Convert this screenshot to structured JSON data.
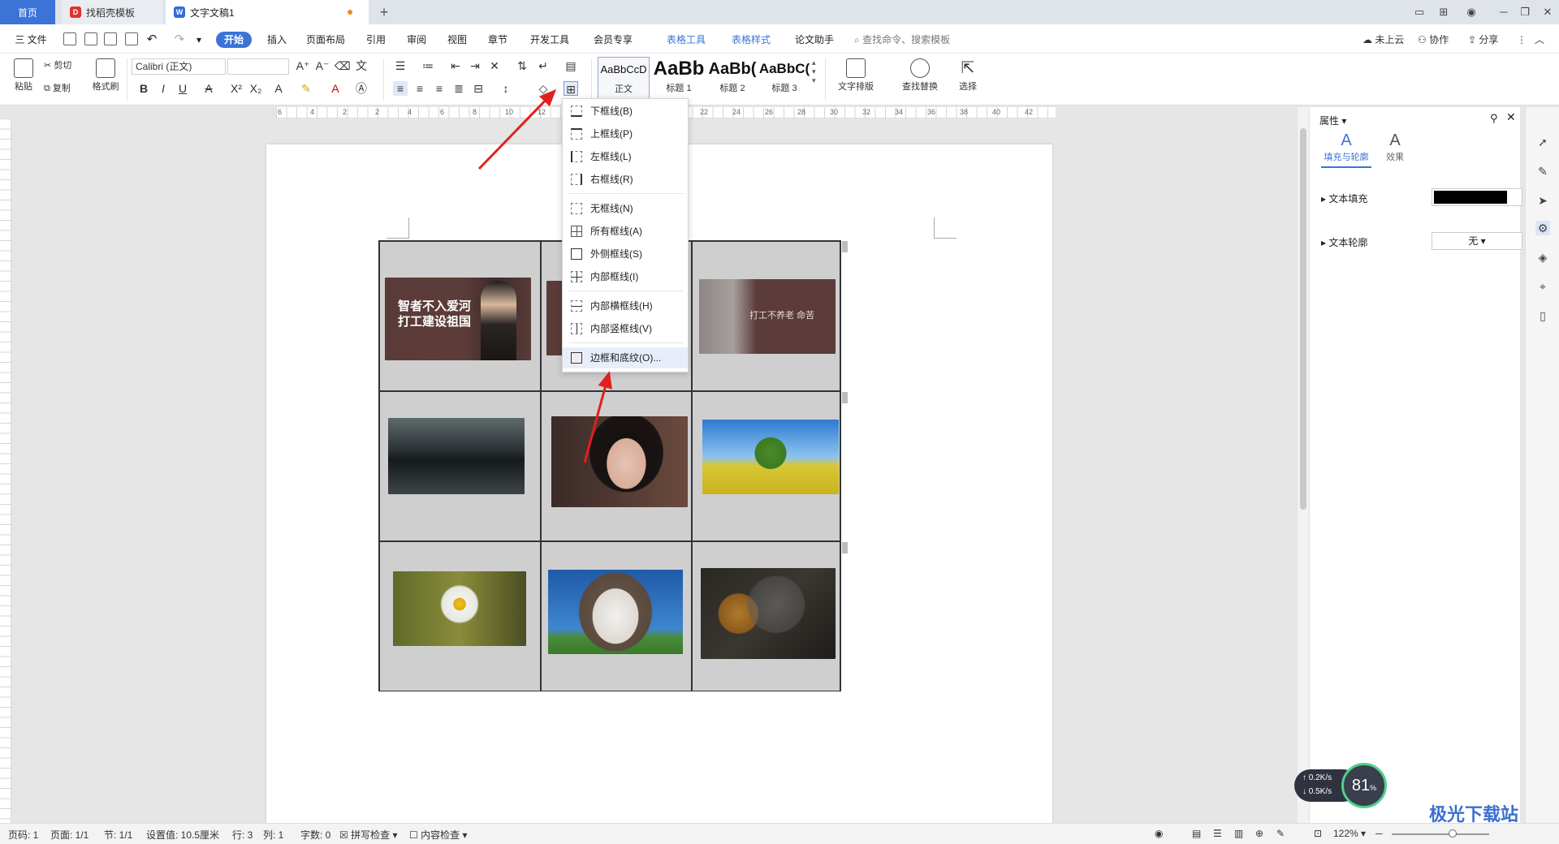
{
  "titlebar": {
    "tabs": [
      {
        "label": "首页"
      },
      {
        "label": "找稻壳模板"
      },
      {
        "label": "文字文稿1"
      }
    ],
    "add_label": "+"
  },
  "menubar": {
    "file": "三 文件",
    "items": [
      "开始",
      "插入",
      "页面布局",
      "引用",
      "审阅",
      "视图",
      "章节",
      "开发工具",
      "会员专享",
      "表格工具",
      "表格样式",
      "论文助手"
    ],
    "search": "查找命令、搜索模板",
    "cloud": "未上云",
    "collab": "协作",
    "share": "分享"
  },
  "ribbon": {
    "paste": "粘贴",
    "cut": "剪切",
    "copy": "复制",
    "format_painter": "格式刷",
    "font_name": "Calibri (正文)",
    "font_size": "",
    "styles": [
      {
        "sample": "AaBbCcD",
        "label": "正文"
      },
      {
        "sample": "AaBb",
        "label": "标题 1"
      },
      {
        "sample": "AaBb(",
        "label": "标题 2"
      },
      {
        "sample": "AaBbC(",
        "label": "标题 3"
      }
    ],
    "text_layout": "文字排版",
    "find_replace": "查找替换",
    "select": "选择"
  },
  "ruler": {
    "labels": [
      "6",
      "4",
      "2",
      "2",
      "4",
      "6",
      "8",
      "10",
      "12",
      "14",
      "16",
      "18",
      "20",
      "22",
      "24",
      "26",
      "28",
      "30",
      "32",
      "34",
      "36",
      "38",
      "40",
      "42"
    ]
  },
  "border_menu": {
    "items": [
      {
        "label": "下框线(B)"
      },
      {
        "label": "上框线(P)"
      },
      {
        "label": "左框线(L)"
      },
      {
        "label": "右框线(R)"
      },
      {
        "label": "无框线(N)"
      },
      {
        "label": "所有框线(A)"
      },
      {
        "label": "外侧框线(S)"
      },
      {
        "label": "内部框线(I)"
      },
      {
        "label": "内部横框线(H)"
      },
      {
        "label": "内部竖框线(V)"
      },
      {
        "label": "边框和底纹(O)..."
      }
    ]
  },
  "table_images": {
    "banner1": "智者不入爱河\n打工建设祖国",
    "banner1_line1": "智者不入爱河",
    "banner1_line2": "打工建设祖国",
    "banner3": "打工不养老 命苦"
  },
  "properties_panel": {
    "title": "属性 ▾",
    "tab_fill": "填充与轮廓",
    "tab_effect": "效果",
    "text_fill": "文本填充",
    "text_outline": "文本轮廓",
    "outline_value": "无",
    "fill_color": "#000000"
  },
  "statusbar": {
    "page": "页码: 1",
    "pages": "页面: 1/1",
    "section": "节: 1/1",
    "setting": "设置值: 10.5厘米",
    "row": "行: 3",
    "col": "列: 1",
    "words": "字数: 0",
    "spell": "拼写检查",
    "content": "内容检查",
    "zoom": "122%"
  },
  "speed_widget": {
    "up": "0.2K/s",
    "down": "0.5K/s",
    "percent": "81"
  },
  "watermark": "极光下载站",
  "colors": {
    "accent": "#3b73d6",
    "cell_fill": "#cfcfcf",
    "arrow": "#e02020"
  }
}
